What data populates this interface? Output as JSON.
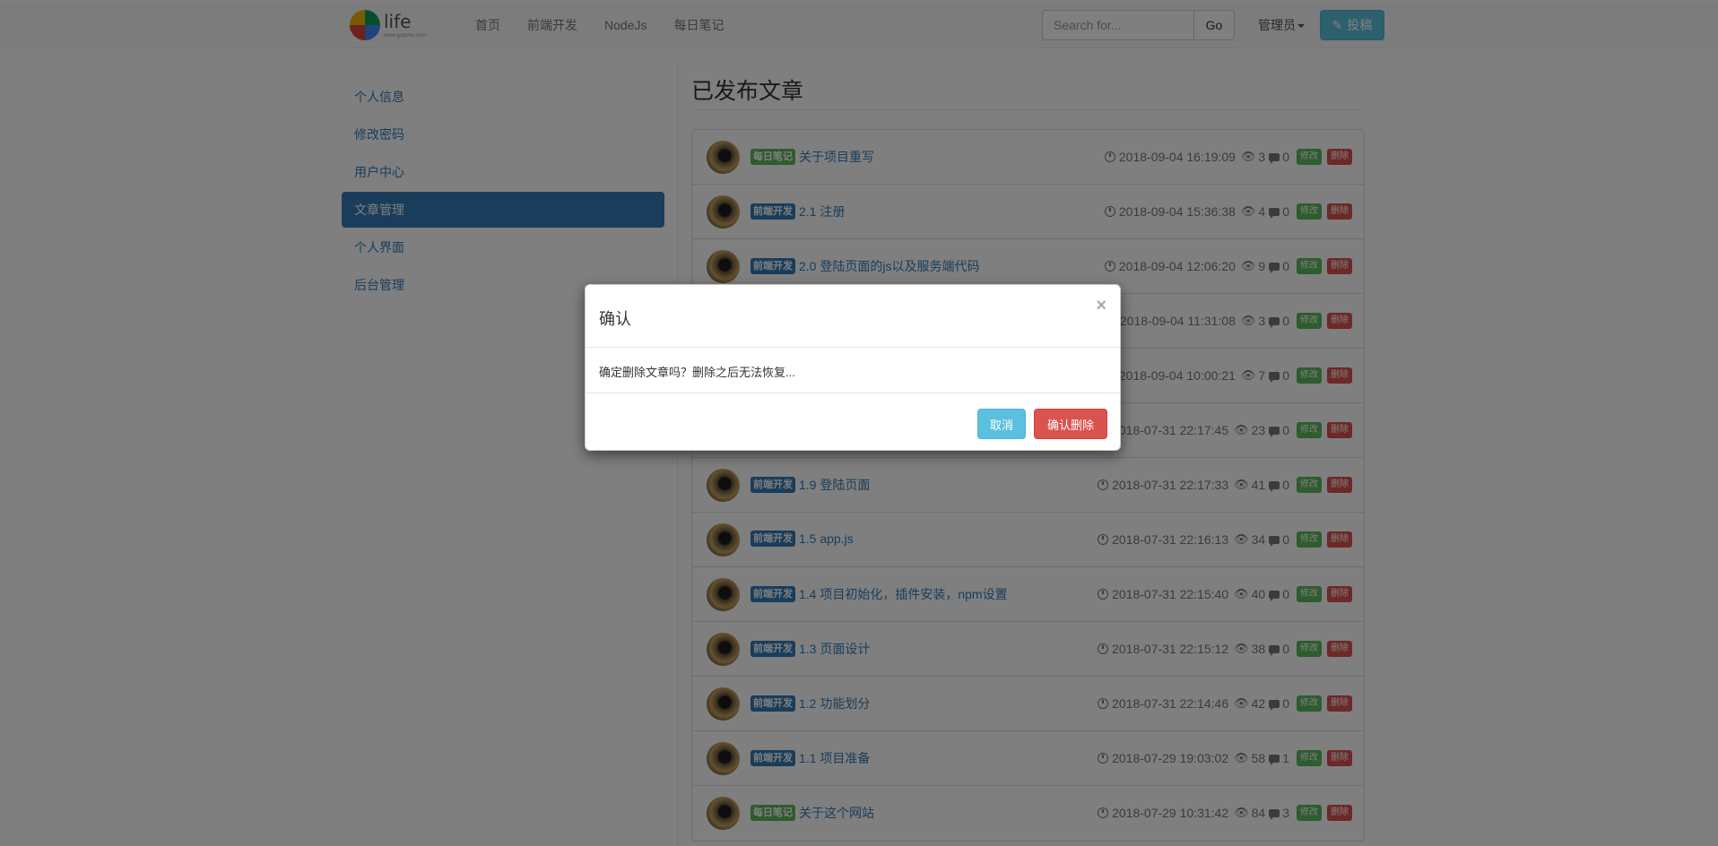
{
  "navbar": {
    "logo": {
      "word": "life",
      "url": "www.godchu.com"
    },
    "links": [
      "首页",
      "前端开发",
      "NodeJs",
      "每日笔记"
    ],
    "search": {
      "placeholder": "Search for...",
      "button": "Go"
    },
    "admin_label": "管理员",
    "post_button": "投稿"
  },
  "sidebar": {
    "items": [
      {
        "label": "个人信息",
        "active": false
      },
      {
        "label": "修改密码",
        "active": false
      },
      {
        "label": "用户中心",
        "active": false
      },
      {
        "label": "文章管理",
        "active": true
      },
      {
        "label": "个人界面",
        "active": false
      },
      {
        "label": "后台管理",
        "active": false
      }
    ]
  },
  "main": {
    "title": "已发布文章",
    "actions": {
      "edit": "修改",
      "delete": "删除"
    },
    "posts": [
      {
        "category": "每日笔记",
        "cat_color": "green",
        "title": "关于项目重写",
        "time": "2018-09-04 16:19:09",
        "views": "3",
        "comments": "0"
      },
      {
        "category": "前端开发",
        "cat_color": "blue",
        "title": "2.1 注册",
        "time": "2018-09-04 15:36:38",
        "views": "4",
        "comments": "0"
      },
      {
        "category": "前端开发",
        "cat_color": "blue",
        "title": "2.0 登陆页面的js以及服务端代码",
        "time": "2018-09-04 12:06:20",
        "views": "9",
        "comments": "0"
      },
      {
        "category": "",
        "cat_color": "blue",
        "title": "",
        "time": "2018-09-04 11:31:08",
        "views": "3",
        "comments": "0"
      },
      {
        "category": "",
        "cat_color": "blue",
        "title": "",
        "time": "2018-09-04 10:00:21",
        "views": "7",
        "comments": "0"
      },
      {
        "category": "",
        "cat_color": "blue",
        "title": "",
        "time": "2018-07-31 22:17:45",
        "views": "23",
        "comments": "0"
      },
      {
        "category": "前端开发",
        "cat_color": "blue",
        "title": "1.9 登陆页面",
        "time": "2018-07-31 22:17:33",
        "views": "41",
        "comments": "0"
      },
      {
        "category": "前端开发",
        "cat_color": "blue",
        "title": "1.5 app.js",
        "time": "2018-07-31 22:16:13",
        "views": "34",
        "comments": "0"
      },
      {
        "category": "前端开发",
        "cat_color": "blue",
        "title": "1.4 项目初始化，插件安装，npm设置",
        "time": "2018-07-31 22:15:40",
        "views": "40",
        "comments": "0"
      },
      {
        "category": "前端开发",
        "cat_color": "blue",
        "title": "1.3 页面设计",
        "time": "2018-07-31 22:15:12",
        "views": "38",
        "comments": "0"
      },
      {
        "category": "前端开发",
        "cat_color": "blue",
        "title": "1.2 功能划分",
        "time": "2018-07-31 22:14:46",
        "views": "42",
        "comments": "0"
      },
      {
        "category": "前端开发",
        "cat_color": "blue",
        "title": "1.1 项目准备",
        "time": "2018-07-29 19:03:02",
        "views": "58",
        "comments": "1"
      },
      {
        "category": "每日笔记",
        "cat_color": "green",
        "title": "关于这个网站",
        "time": "2018-07-29 10:31:42",
        "views": "84",
        "comments": "3"
      }
    ]
  },
  "modal": {
    "title": "确认",
    "close": "×",
    "message": "确定删除文章吗？删除之后无法恢复...",
    "cancel": "取消",
    "confirm": "确认删除"
  },
  "colors": {
    "primary": "#337ab7",
    "info": "#5bc0de",
    "success": "#5cb85c",
    "danger": "#d9534f"
  }
}
